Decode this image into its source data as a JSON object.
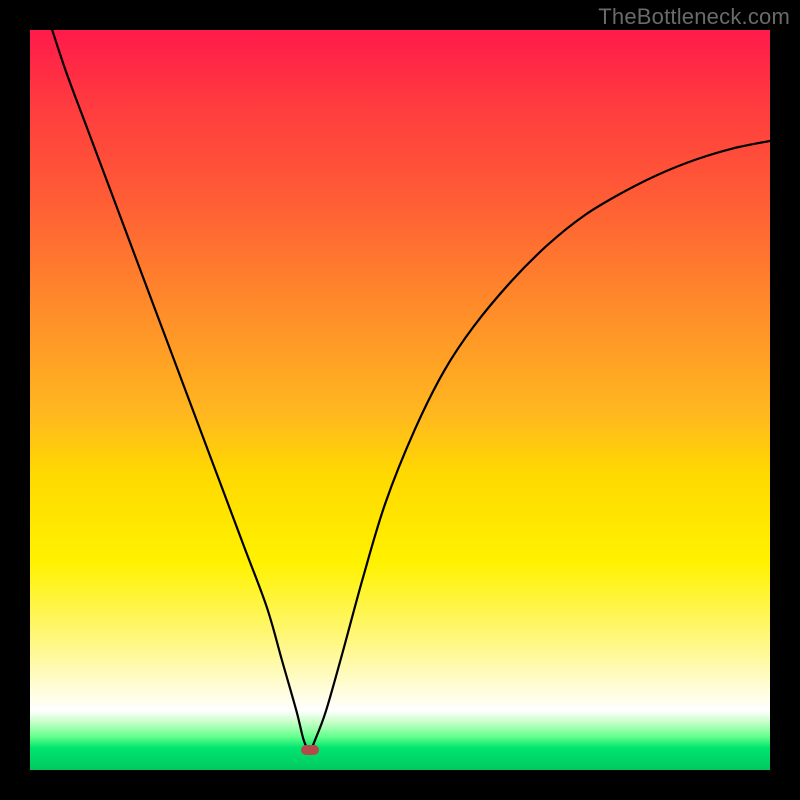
{
  "watermark": "TheBottleneck.com",
  "marker": {
    "x_pct": 37.8,
    "y_pct": 97.3
  },
  "chart_data": {
    "type": "line",
    "title": "",
    "xlabel": "",
    "ylabel": "",
    "xlim": [
      0,
      100
    ],
    "ylim": [
      0,
      100
    ],
    "gradient_legend_note": "background encodes bottleneck severity: green (bottom) = optimal, red (top) = severe",
    "series": [
      {
        "name": "bottleneck-curve",
        "x": [
          3,
          5,
          8,
          11,
          14,
          17,
          20,
          23,
          26,
          29,
          32,
          34,
          36,
          37,
          37.8,
          38.5,
          40,
          42,
          45,
          48,
          52,
          56,
          60,
          65,
          70,
          75,
          80,
          85,
          90,
          95,
          100
        ],
        "y": [
          100,
          94,
          86,
          78,
          70,
          62,
          54,
          46,
          38,
          30,
          22,
          15,
          8,
          4,
          2.7,
          4,
          8,
          15,
          26,
          36,
          46,
          54,
          60,
          66,
          71,
          75,
          78,
          80.5,
          82.5,
          84,
          85
        ]
      }
    ],
    "annotations": [
      {
        "type": "point",
        "name": "optimal-point",
        "x": 37.8,
        "y": 2.7
      }
    ]
  }
}
